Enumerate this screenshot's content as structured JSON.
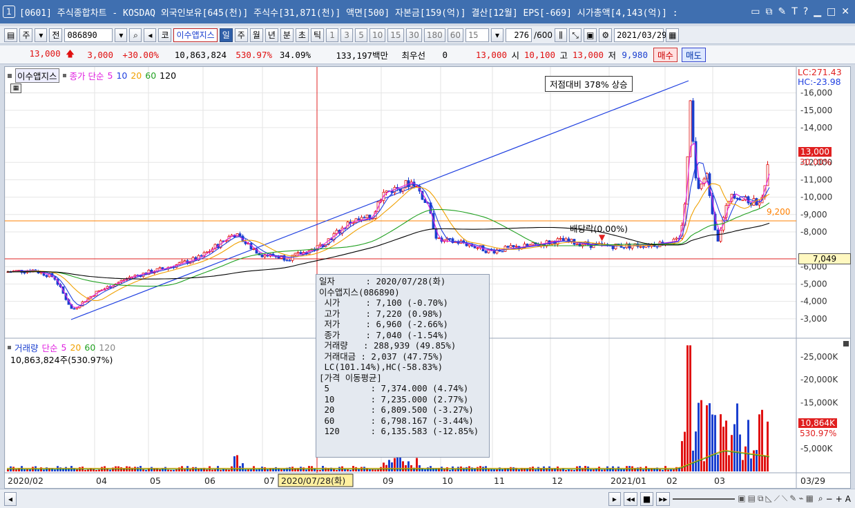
{
  "titlebar": {
    "window_number": "1",
    "title": "[0601] 주식종합차트 - KOSDAQ 외국인보유[645(천)] 주식수[31,871(천)] 액면[500] 자본금[159(억)] 결산[12월] EPS[-669] 시가총액[4,143(억)] :"
  },
  "toolbar": {
    "market": "주",
    "prev_label": "전",
    "code": "086890",
    "exchange_badge": "코",
    "stock_name": "이수앱지스",
    "periods": [
      "일",
      "주",
      "월",
      "년",
      "분",
      "초",
      "틱"
    ],
    "minutes": [
      "1",
      "3",
      "5",
      "10",
      "15",
      "30",
      "180",
      "60"
    ],
    "interval_value": "15",
    "count_value": "276",
    "count_total": "/600",
    "date": "2021/03/29"
  },
  "quote": {
    "price": "13,000",
    "change": "3,000",
    "change_pct": "+30.00%",
    "volume": "10,863,824",
    "volume_ratio": "530.97%",
    "turnover": "34.09%",
    "amount": "133,197백만",
    "best_label": "최우선",
    "best_value": "0",
    "price2": "13,000",
    "open_label": "시",
    "open": "10,100",
    "high_label": "고",
    "high": "13,000",
    "low_label": "저",
    "low": "9,980",
    "buy": "매수",
    "sell": "매도"
  },
  "price_panel": {
    "stock_name": "이수앱지스",
    "ma_title": "종가 단순",
    "ma_periods": [
      "5",
      "10",
      "20",
      "60",
      "120"
    ],
    "lc": "LC:271.43",
    "hc": "HC:-23.98",
    "annotation": "저점대비 378% 상승",
    "dividend": "배당락(0.00%)",
    "hline_label": "9,200",
    "current_label": "13,000",
    "current_pct": "30.00%",
    "crosshair_label": "7,049",
    "y_ticks": [
      "16,000",
      "15,000",
      "14,000",
      "13,000",
      "12,000",
      "11,000",
      "10,000",
      "9,000",
      "8,000",
      "6,000",
      "5,000",
      "4,000",
      "3,000"
    ]
  },
  "volume_panel": {
    "title": "거래량",
    "ma_title": "단순",
    "ma_periods": [
      "5",
      "20",
      "60",
      "120"
    ],
    "total": "10,863,824주(530.97%)",
    "current_label": "10,864K",
    "current_pct": "530.97%",
    "y_ticks": [
      "25,000K",
      "20,000K",
      "15,000K",
      "5,000K"
    ]
  },
  "x_axis": {
    "labels": [
      "2020/02",
      "04",
      "05",
      "06",
      "07",
      "2020/07/28(화)",
      "09",
      "10",
      "11",
      "12",
      "2021/01",
      "02",
      "03",
      "03/29"
    ]
  },
  "infobox": {
    "lines": [
      "일자      : 2020/07/28(화)",
      "이수앱지스(086890)",
      " 시가     : 7,100 (-0.70%)",
      " 고가     : 7,220 (0.98%)",
      " 저가     : 6,960 (-2.66%)",
      " 종가     : 7,040 (-1.54%)",
      " 거래량   : 288,939 (49.85%)",
      " 거래대금 : 2,037 (47.75%)",
      " LC(101.14%),HC(-58.83%)",
      "[가격 이동평균]",
      " 5        : 7,374.000 (4.74%)",
      " 10       : 7,235.000 (2.77%)",
      " 20       : 6,809.500 (-3.27%)",
      " 60       : 6,798.167 (-3.44%)",
      " 120      : 6,135.583 (-12.85%)"
    ]
  },
  "colors": {
    "up": "#e01010",
    "down": "#1a3fcf",
    "ma5": "#e020e0",
    "ma10": "#2040e0",
    "ma20": "#f0a000",
    "ma60": "#20a020",
    "ma120": "#000000",
    "hline": "#ff8000",
    "trend": "#2040e0"
  }
}
